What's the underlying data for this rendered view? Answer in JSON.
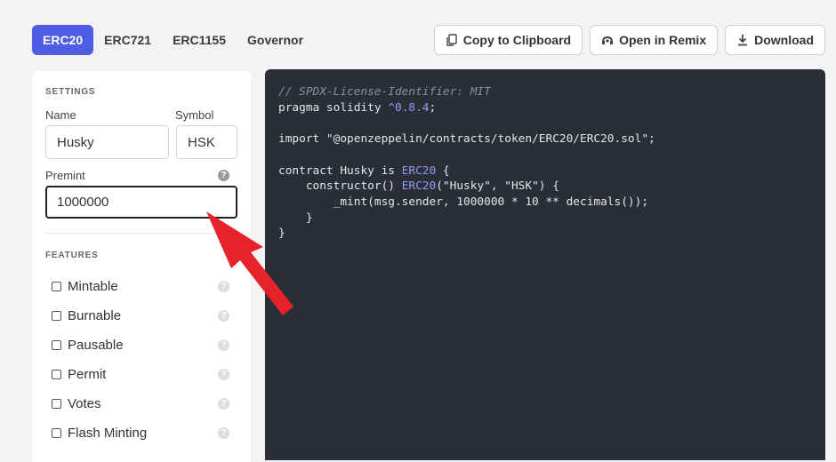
{
  "tabs": [
    {
      "label": "ERC20",
      "active": true
    },
    {
      "label": "ERC721",
      "active": false
    },
    {
      "label": "ERC1155",
      "active": false
    },
    {
      "label": "Governor",
      "active": false
    }
  ],
  "actions": {
    "copy_label": "Copy to Clipboard",
    "remix_label": "Open in Remix",
    "download_label": "Download"
  },
  "settings": {
    "title": "SETTINGS",
    "name_label": "Name",
    "name_value": "Husky",
    "symbol_label": "Symbol",
    "symbol_value": "HSK",
    "premint_label": "Premint",
    "premint_value": "1000000"
  },
  "features": {
    "title": "FEATURES",
    "items": [
      {
        "label": "Mintable",
        "checked": false
      },
      {
        "label": "Burnable",
        "checked": false
      },
      {
        "label": "Pausable",
        "checked": false
      },
      {
        "label": "Permit",
        "checked": false
      },
      {
        "label": "Votes",
        "checked": false
      },
      {
        "label": "Flash Minting",
        "checked": false
      }
    ]
  },
  "code": {
    "line1": "// SPDX-License-Identifier: MIT",
    "line2_kw": "pragma solidity ",
    "line2_ver": "^0.8.4",
    "line2_end": ";",
    "line4": "import \"@openzeppelin/contracts/token/ERC20/ERC20.sol\";",
    "line6_a": "contract Husky is ",
    "line6_b": "ERC20",
    "line6_c": " {",
    "line7_a": "    constructor() ",
    "line7_b": "ERC20",
    "line7_c": "(\"Husky\", \"HSK\") {",
    "line8": "        _mint(msg.sender, 1000000 * 10 ** decimals());",
    "line9": "    }",
    "line10": "}"
  },
  "colors": {
    "accent": "#4e5de4",
    "code_bg": "#2b2e37",
    "annotation_arrow": "#e8222a"
  }
}
